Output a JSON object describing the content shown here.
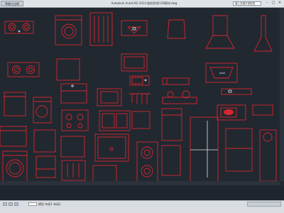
{
  "titlebar": {
    "app_menu_label": "草图与注释",
    "title": "Autodesk AutoCAD 2014   厨房家电CAD图块.dwg",
    "search_value": "键入关键字或短语",
    "minimize": "–",
    "maximize": "□",
    "close": "✕"
  },
  "statusbar": {
    "coordinates": "模型 布局1 布局2"
  },
  "colors": {
    "canvas_bg": "#212830",
    "line": "#d7262f",
    "accent_line": "#e6e6e6"
  }
}
